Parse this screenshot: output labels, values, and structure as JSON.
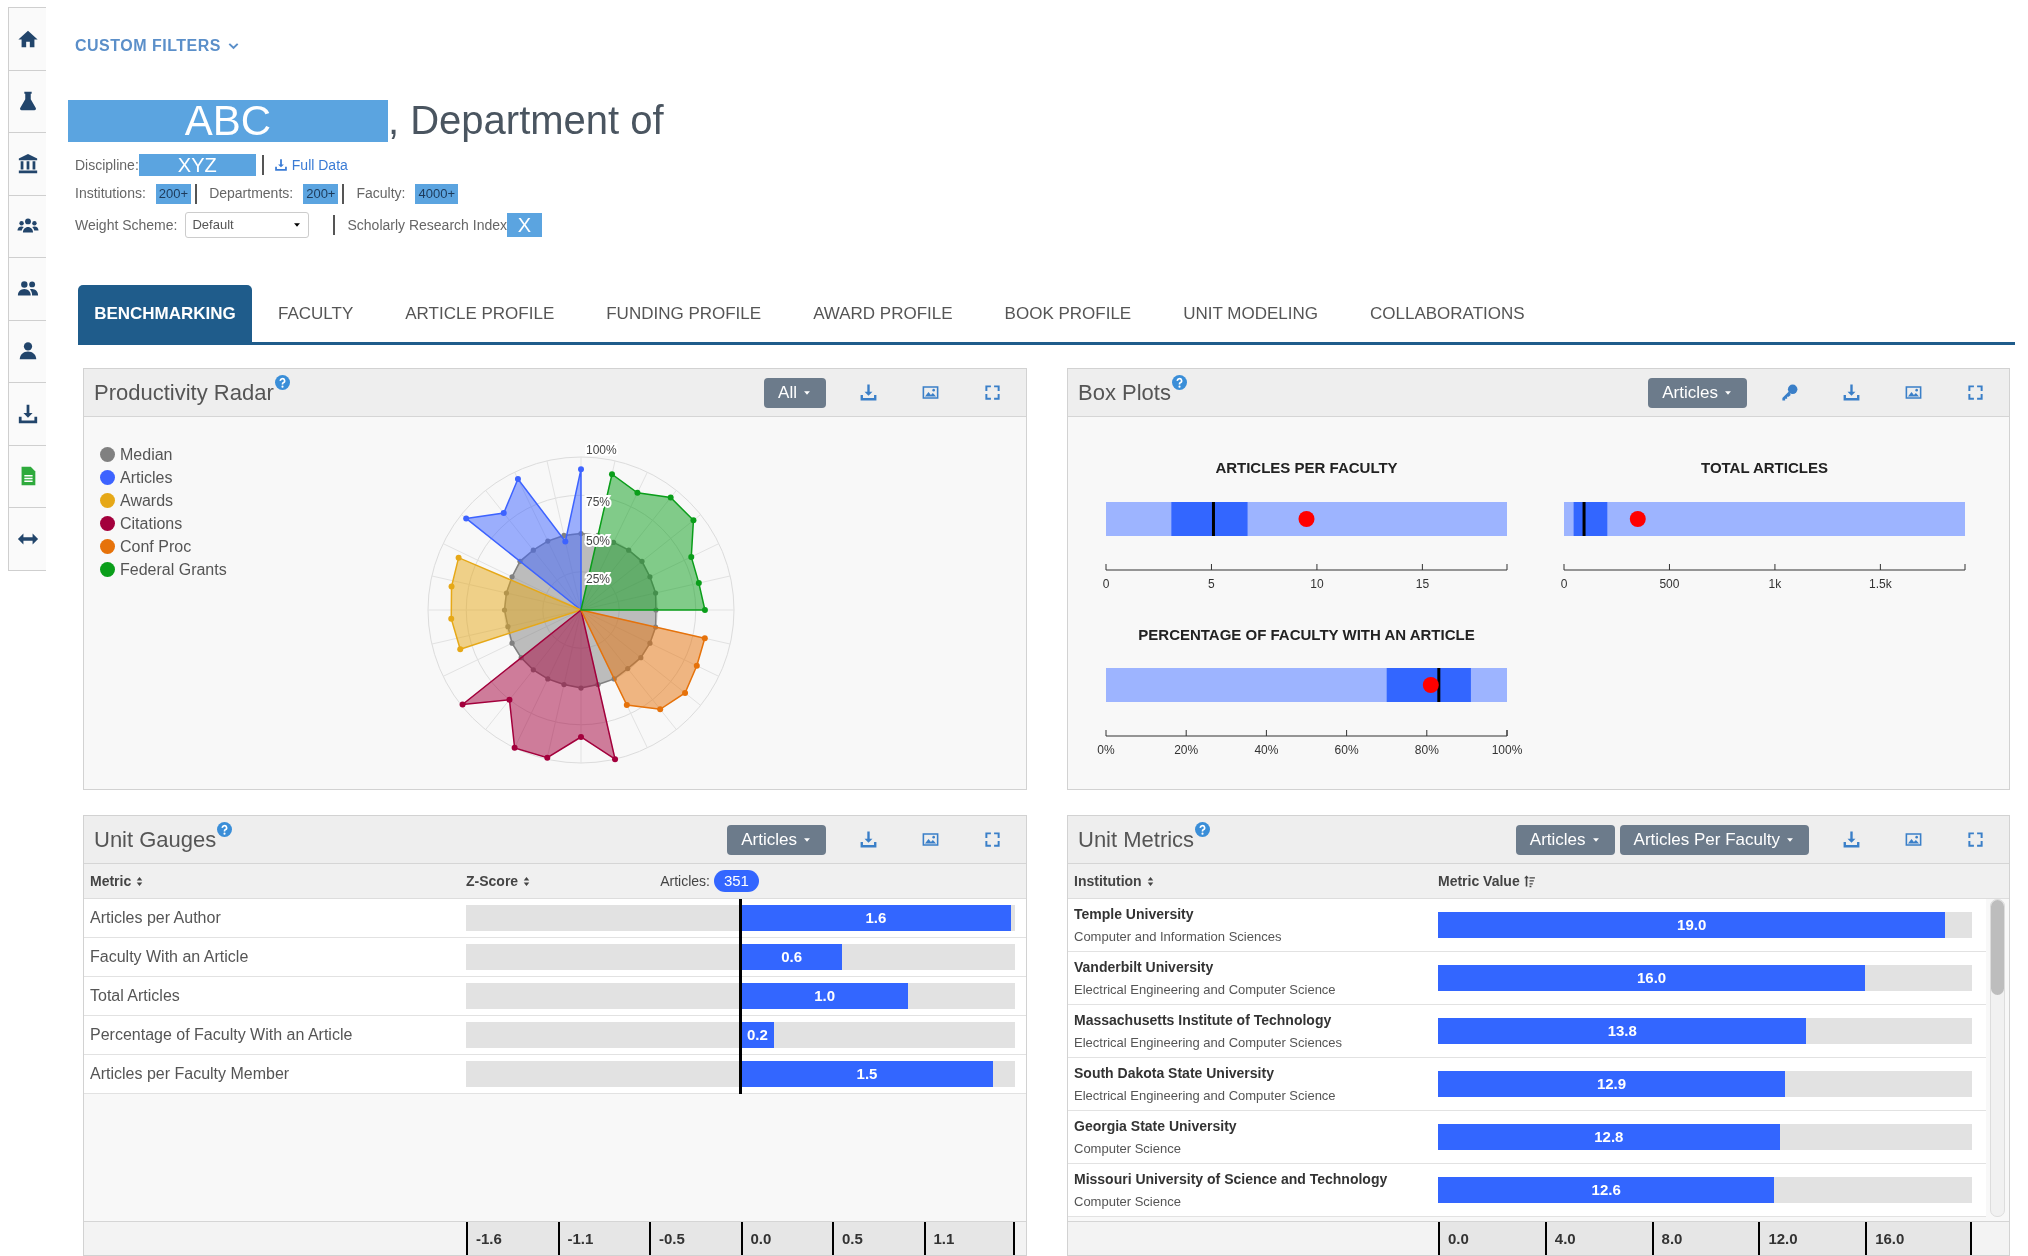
{
  "sidebar": {
    "items": [
      {
        "kind": "home"
      },
      {
        "kind": "flask"
      },
      {
        "kind": "bank"
      },
      {
        "kind": "group"
      },
      {
        "kind": "people"
      },
      {
        "kind": "person"
      },
      {
        "kind": "download"
      },
      {
        "kind": "document"
      },
      {
        "kind": "arrows"
      }
    ]
  },
  "filters_toggle": {
    "label": "CUSTOM FILTERS"
  },
  "title": {
    "highlight": "ABC",
    "rest": ", Department of"
  },
  "discipline": {
    "label": "Discipline:",
    "value": "XYZ",
    "link": "Full Data"
  },
  "counts": [
    {
      "label": "Institutions:",
      "value": "200+"
    },
    {
      "label": "Departments:",
      "value": "200+"
    },
    {
      "label": "Faculty:",
      "value": "4000+"
    }
  ],
  "weight_scheme": {
    "label": "Weight Scheme:",
    "value": "Default"
  },
  "index": {
    "label": "Scholarly Research Index",
    "value": "X"
  },
  "tabs": [
    {
      "label": "BENCHMARKING",
      "selected": true
    },
    {
      "label": "FACULTY",
      "selected": false
    },
    {
      "label": "ARTICLE PROFILE",
      "selected": false
    },
    {
      "label": "FUNDING PROFILE",
      "selected": false
    },
    {
      "label": "AWARD PROFILE",
      "selected": false
    },
    {
      "label": "BOOK PROFILE",
      "selected": false
    },
    {
      "label": "UNIT MODELING",
      "selected": false
    },
    {
      "label": "COLLABORATIONS",
      "selected": false
    }
  ],
  "radar": {
    "title": "Productivity Radar",
    "dropdowns": [
      "All"
    ],
    "legend": [
      {
        "label": "Median",
        "color": "#808080"
      },
      {
        "label": "Articles",
        "color": "#3d63ff"
      },
      {
        "label": "Awards",
        "color": "#e6a817"
      },
      {
        "label": "Citations",
        "color": "#a3003c"
      },
      {
        "label": "Conf Proc",
        "color": "#e6720a"
      },
      {
        "label": "Federal Grants",
        "color": "#0a9e1a"
      }
    ],
    "ring_labels": [
      "100%",
      "75%",
      "50%",
      "25%"
    ]
  },
  "box_plots": {
    "title": "Box Plots",
    "dropdowns": [
      "Articles"
    ],
    "plots": [
      {
        "title": "ARTICLES PER FACULTY",
        "tick_labels": [
          "0",
          "5",
          "10",
          "15"
        ]
      },
      {
        "title": "TOTAL ARTICLES",
        "tick_labels": [
          "0",
          "500",
          "1k",
          "1.5k"
        ]
      },
      {
        "title": "PERCENTAGE OF FACULTY WITH AN ARTICLE",
        "tick_labels": [
          "0%",
          "20%",
          "40%",
          "60%",
          "80%",
          "100%"
        ]
      }
    ]
  },
  "unit_gauges": {
    "title": "Unit Gauges",
    "dropdowns": [
      "Articles"
    ],
    "columns": [
      "Metric",
      "Z-Score"
    ],
    "count_label": "Articles:",
    "count": "351",
    "rows": [
      {
        "metric": "Articles per Author",
        "value": "1.6",
        "level": 0.985
      },
      {
        "metric": "Faculty With an Article",
        "value": "0.6",
        "level": 0.37
      },
      {
        "metric": "Total Articles",
        "value": "1.0",
        "level": 0.61
      },
      {
        "metric": "Percentage of Faculty With an Article",
        "value": "0.2",
        "level": 0.12
      },
      {
        "metric": "Articles per Faculty Member",
        "value": "1.5",
        "level": 0.92
      }
    ],
    "axis_labels": [
      "-1.6",
      "-1.1",
      "-0.5",
      "0.0",
      "0.5",
      "1.1"
    ]
  },
  "unit_metrics": {
    "title": "Unit Metrics",
    "dropdowns": [
      "Articles",
      "Articles Per Faculty"
    ],
    "columns": [
      "Institution",
      "Metric Value"
    ],
    "rows": [
      {
        "institution": "Temple University",
        "department": "Computer and Information Sciences",
        "value": "19.0",
        "level": 0.95
      },
      {
        "institution": "Vanderbilt University",
        "department": "Electrical Engineering and Computer Science",
        "value": "16.0",
        "level": 0.8
      },
      {
        "institution": "Massachusetts Institute of Technology",
        "department": "Electrical Engineering and Computer Sciences",
        "value": "13.8",
        "level": 0.69
      },
      {
        "institution": "South Dakota State University",
        "department": "Electrical Engineering and Computer Science",
        "value": "12.9",
        "level": 0.65
      },
      {
        "institution": "Georgia State University",
        "department": "Computer Science",
        "value": "12.8",
        "level": 0.64
      },
      {
        "institution": "Missouri University of Science and Technology",
        "department": "Computer Science",
        "value": "12.6",
        "level": 0.63
      }
    ],
    "axis_labels": [
      "0.0",
      "4.0",
      "8.0",
      "12.0",
      "16.0"
    ]
  }
}
